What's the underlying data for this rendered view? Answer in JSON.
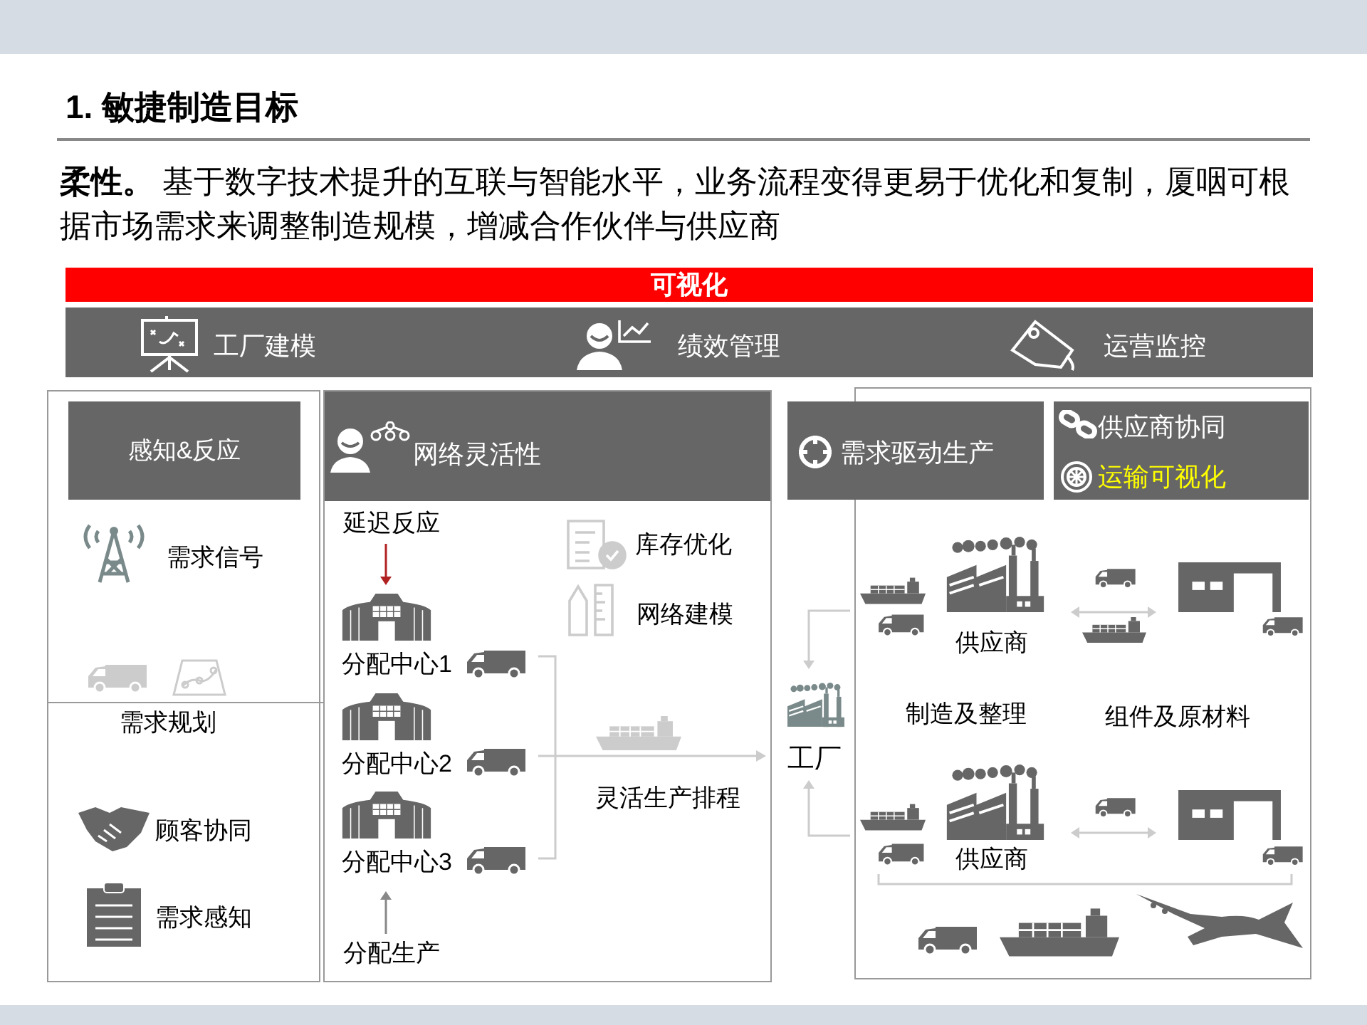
{
  "title": "1. 敏捷制造目标",
  "intro": "**柔性。** 基于数字技术提升的互联与智能水平，业务流程变得更易于优化和复制，厦咽可根据市场需求来调整制造规模，增减合作伙伴与供应商",
  "banner": "可视化",
  "capabilities": [
    "工厂建模",
    "绩效管理",
    "运营监控"
  ],
  "sense": {
    "header": "感知&反应",
    "signal": "需求信号",
    "planning": "需求规划",
    "collaboration": "顾客协同",
    "sensing": "需求感知"
  },
  "network": {
    "header": "网络灵活性",
    "delay": "延迟反应",
    "inventory": "库存优化",
    "modeling": "网络建模",
    "centers": [
      "分配中心1",
      "分配中心2",
      "分配中心3"
    ],
    "scheduling": "灵活生产排程",
    "allocation": "分配生产"
  },
  "demand": {
    "header": "需求驱动生产",
    "factory": "工厂"
  },
  "supply": {
    "items": [
      {
        "label": "供应商协同",
        "highlighted": false
      },
      {
        "label": "运输可视化",
        "highlighted": true
      }
    ],
    "suppliers": [
      "供应商",
      "供应商"
    ],
    "manufacturing": "制造及整理",
    "components": "组件及原材料"
  }
}
